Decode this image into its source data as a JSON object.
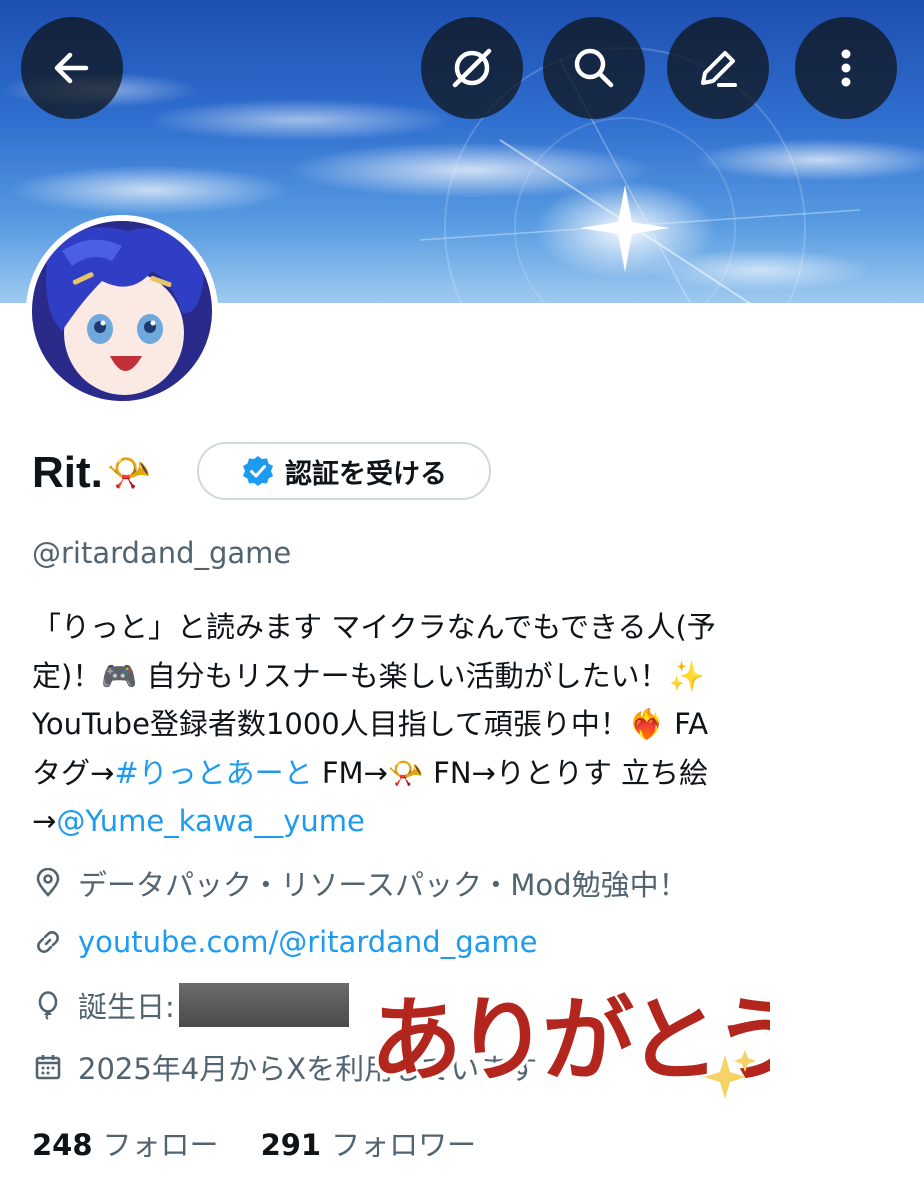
{
  "header": {
    "back_icon": "arrow-left-icon",
    "actions": [
      {
        "icon": "grok-icon"
      },
      {
        "icon": "search-icon"
      },
      {
        "icon": "edit-icon"
      },
      {
        "icon": "more-vertical-icon"
      }
    ]
  },
  "profile": {
    "display_name": "Rit.",
    "name_emoji": "📯",
    "verify_label": "認証を受ける",
    "handle": "@ritardand_game",
    "bio": {
      "line1": "「りっと」と読みます マイクラなんでもできる人(予",
      "line2": "定)！🎮 自分もリスナーも楽しい活動がしたい！✨",
      "line3": "YouTube登録者数1000人目指して頑張り中！❤️‍🔥 FA",
      "line4_prefix": "タグ→",
      "hashtag": "#りっとあーと",
      "line4_suffix": " FM→📯 FN→りとりす 立ち絵",
      "line5_prefix": "→",
      "mention": "@Yume_kawa__yume"
    },
    "location": "データパック・リソースパック・Mod勉強中！",
    "website": "youtube.com/@ritardand_game",
    "birthday_label": "誕生日:",
    "joined": "2025年4月からXを利用しています",
    "following_count": "248",
    "following_label": "フォロー",
    "followers_count": "291",
    "followers_label": "フォロワー"
  },
  "overlay_sticker": "ありがとう",
  "colors": {
    "link": "#1d9bf0",
    "secondary_text": "#536471",
    "verified_badge": "#1d9bf0",
    "sticker": "#b3261e"
  }
}
